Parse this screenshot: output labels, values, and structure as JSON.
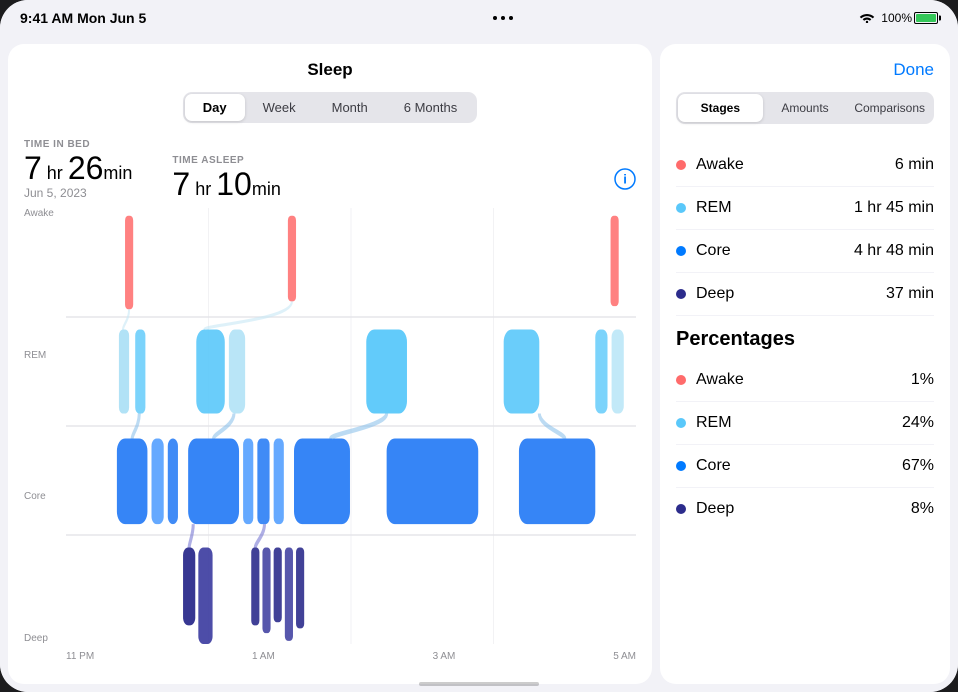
{
  "statusBar": {
    "time": "9:41 AM",
    "date": "Mon Jun 5",
    "battery": "100%"
  },
  "header": {
    "title": "Sleep",
    "doneLabel": "Done"
  },
  "segments": [
    {
      "label": "Day",
      "active": true
    },
    {
      "label": "Week",
      "active": false
    },
    {
      "label": "Month",
      "active": false
    },
    {
      "label": "6 Months",
      "active": false
    }
  ],
  "stats": {
    "timeInBed": {
      "label": "TIME IN BED",
      "hours": "7",
      "minutes": "26",
      "hrUnit": "hr",
      "minUnit": "min"
    },
    "timeAsleep": {
      "label": "TIME ASLEEP",
      "hours": "7",
      "minutes": "10",
      "hrUnit": "hr",
      "minUnit": "min"
    },
    "date": "Jun 5, 2023"
  },
  "chartLabels": [
    "Awake",
    "REM",
    "Core",
    "Deep"
  ],
  "timeLabels": [
    "11 PM",
    "1 AM",
    "3 AM",
    "5 AM"
  ],
  "tabs": [
    {
      "label": "Stages",
      "active": true
    },
    {
      "label": "Amounts",
      "active": false
    },
    {
      "label": "Comparisons",
      "active": false
    }
  ],
  "stages": [
    {
      "name": "Awake",
      "value": "6 min",
      "color": "#ff6b6b"
    },
    {
      "name": "REM",
      "value": "1 hr 45 min",
      "color": "#5ac8fa"
    },
    {
      "name": "Core",
      "value": "4 hr 48 min",
      "color": "#007aff"
    },
    {
      "name": "Deep",
      "value": "37 min",
      "color": "#2c2c8c"
    }
  ],
  "percentagesTitle": "Percentages",
  "percentages": [
    {
      "name": "Awake",
      "value": "1%",
      "color": "#ff6b6b"
    },
    {
      "name": "REM",
      "value": "24%",
      "color": "#5ac8fa"
    },
    {
      "name": "Core",
      "value": "67%",
      "color": "#007aff"
    },
    {
      "name": "Deep",
      "value": "8%",
      "color": "#2c2c8c"
    }
  ]
}
